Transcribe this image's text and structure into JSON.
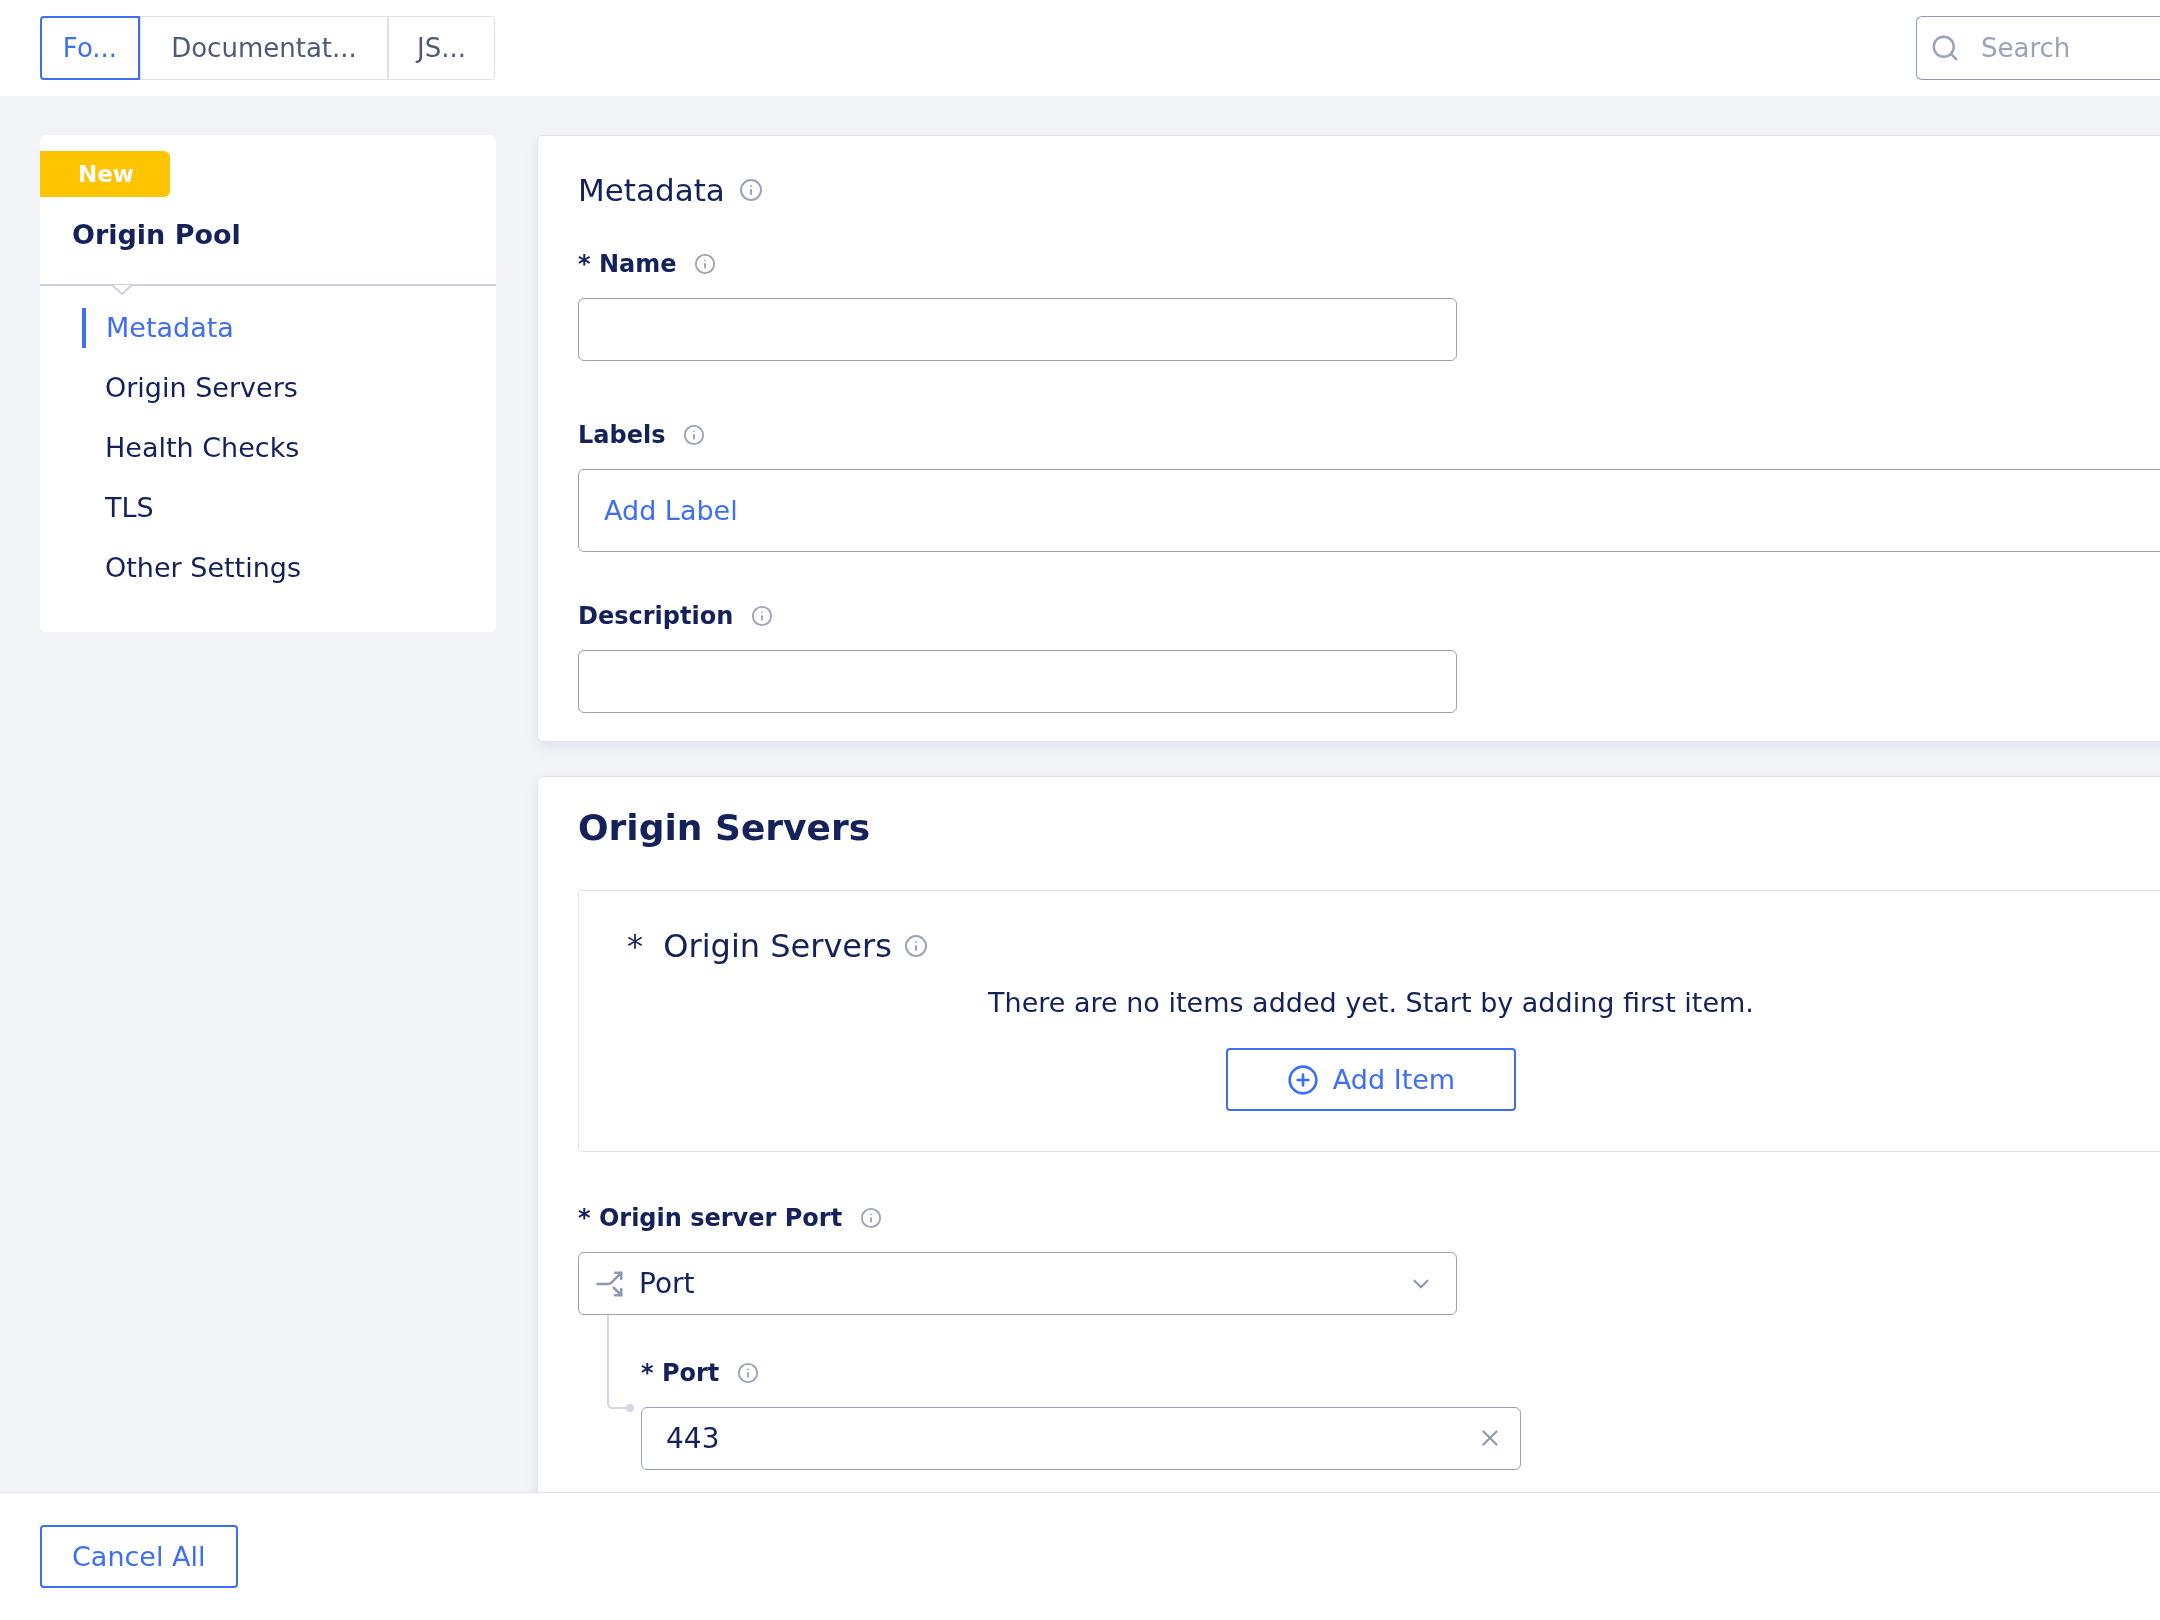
{
  "tabs": [
    {
      "label": "Fo...",
      "selected": true
    },
    {
      "label": "Documentat...",
      "selected": false
    },
    {
      "label": "JS...",
      "selected": false
    }
  ],
  "search": {
    "placeholder": "Search"
  },
  "sidebar": {
    "badge": "New",
    "title": "Origin Pool",
    "items": [
      {
        "label": "Metadata",
        "selected": true
      },
      {
        "label": "Origin Servers",
        "selected": false
      },
      {
        "label": "Health Checks",
        "selected": false
      },
      {
        "label": "TLS",
        "selected": false
      },
      {
        "label": "Other Settings",
        "selected": false
      }
    ]
  },
  "metadata": {
    "title": "Metadata",
    "fields": [
      {
        "kind": "text",
        "label": "* Name"
      },
      {
        "kind": "labels",
        "label": "Labels",
        "action": "Add Label"
      },
      {
        "kind": "text",
        "label": "Description"
      }
    ]
  },
  "origin_servers": {
    "title": "Origin Servers",
    "list": {
      "label": "*  Origin Servers",
      "empty_message": "There are no items added yet. Start by adding first item.",
      "add_button": "Add Item"
    },
    "port_field": {
      "label": "* Origin server Port",
      "selected": "Port",
      "sub_field": {
        "label": "* Port",
        "value": "443"
      }
    }
  },
  "footer": {
    "cancel_button": "Cancel All"
  }
}
